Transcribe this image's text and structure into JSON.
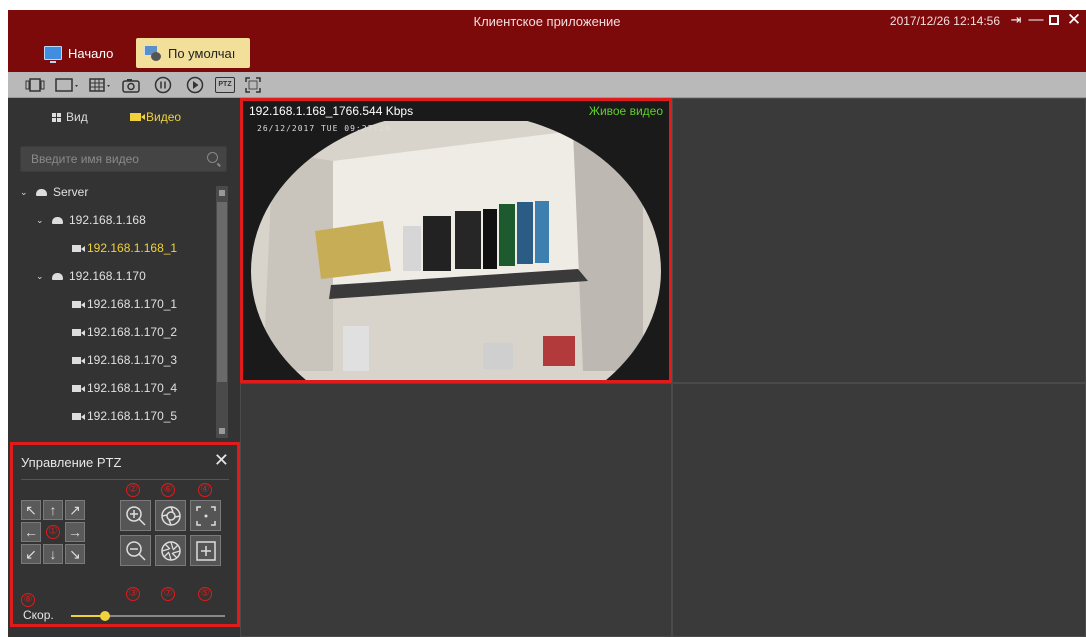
{
  "window": {
    "title": "Клиентское приложение",
    "clock": "2017/12/26 12:14:56",
    "controls": [
      "logout-icon",
      "minimize-icon",
      "maximize-icon",
      "close-icon"
    ]
  },
  "tabs": [
    {
      "label": "Начало",
      "icon": "monitor-icon"
    },
    {
      "label": "По умолчаı",
      "icon": "default-view-icon",
      "active": true
    }
  ],
  "toolbar": {
    "icons": [
      "screen-capture-icon",
      "layout-icon",
      "grid-layout-icon",
      "snapshot-icon",
      "pause-icon",
      "play-icon",
      "ptz-icon",
      "fullscreen-icon"
    ],
    "ptz_label": "PTZ"
  },
  "sidebar": {
    "view_tab": "Вид",
    "video_tab": "Видео",
    "search_placeholder": "Введите имя видео",
    "tree": {
      "server": "Server",
      "nodes": [
        {
          "label": "192.168.1.168",
          "type": "device"
        },
        {
          "label": "192.168.1.168_1",
          "type": "camera",
          "active": true
        },
        {
          "label": "192.168.1.170",
          "type": "device"
        },
        {
          "label": "192.168.1.170_1",
          "type": "camera"
        },
        {
          "label": "192.168.1.170_2",
          "type": "camera"
        },
        {
          "label": "192.168.1.170_3",
          "type": "camera"
        },
        {
          "label": "192.168.1.170_4",
          "type": "camera"
        },
        {
          "label": "192.168.1.170_5",
          "type": "camera"
        }
      ]
    }
  },
  "ptz": {
    "title": "Управление PTZ",
    "speed_label": "Скор.",
    "speed_value": 0.22,
    "markers": [
      "①",
      "②",
      "③",
      "④",
      "⑤",
      "⑥",
      "⑦",
      "⑧"
    ],
    "arrows": [
      "↖",
      "↑",
      "↗",
      "←",
      "→",
      "↙",
      "↓",
      "↘"
    ]
  },
  "video": {
    "channel": "192.168.1.168_1",
    "bitrate": "766.544 Kbps",
    "status": "Живое видео",
    "overlay_timestamp": "26/12/2017  TUE  09:27:26"
  },
  "colors": {
    "title_bar": "#7d0a0a",
    "active_tab": "#f1df9a",
    "accent_yellow": "#f1d23b",
    "highlight_border": "#e01b1b",
    "live_green": "#5fd12b"
  }
}
